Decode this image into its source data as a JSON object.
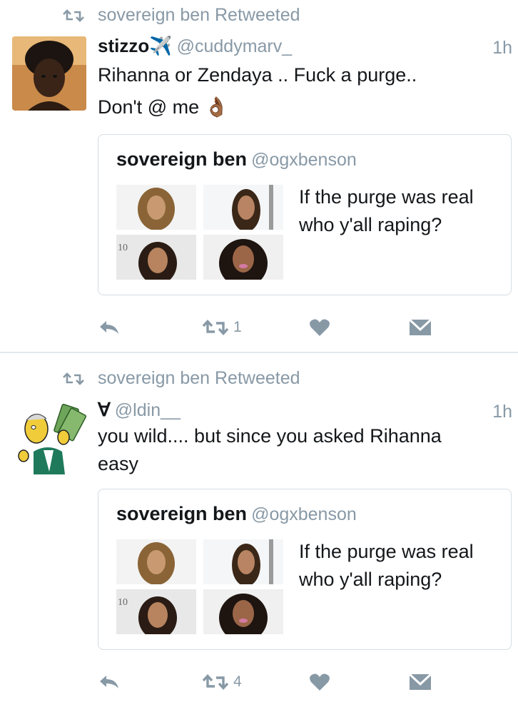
{
  "tweets": [
    {
      "retweeted_by": "sovereign ben Retweeted",
      "author_name": "stizzo",
      "author_emoji": "✈️",
      "author_handle": "@cuddymarv_",
      "time": "1h",
      "text_line1": "Rihanna or Zendaya .. Fuck a purge..",
      "text_line2": "Don't @ me",
      "text_emoji": "👌🏾",
      "quote": {
        "name": "sovereign ben",
        "handle": "@ogxbenson",
        "text": "If the purge was real who y'all raping?"
      },
      "retweet_count": "1"
    },
    {
      "retweeted_by": "sovereign ben Retweeted",
      "author_name": "∀",
      "author_handle": "@ldin__",
      "time": "1h",
      "text_line1": "you wild.... but since you asked Rihanna",
      "text_line2": "easy",
      "quote": {
        "name": "sovereign ben",
        "handle": "@ogxbenson",
        "text": "If the purge was real who y'all raping?"
      },
      "retweet_count": "4"
    }
  ],
  "colors": {
    "muted": "#8899a6",
    "text": "#14171a",
    "border": "#d5dde3"
  },
  "icons": [
    "retweet-icon",
    "reply-icon",
    "like-icon",
    "direct-message-icon"
  ]
}
